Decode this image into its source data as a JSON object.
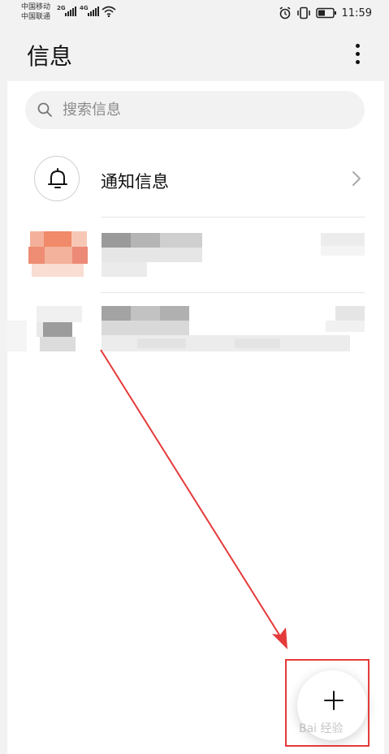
{
  "status_bar": {
    "carrier_1": "中国移动",
    "carrier_2": "中国联通",
    "net_1": "2G",
    "net_2": "4G",
    "time": "11:59",
    "icons": [
      "signal-icon",
      "wifi-icon",
      "alarm-icon",
      "vibrate-icon",
      "battery-icon"
    ]
  },
  "header": {
    "title": "信息",
    "menu_icon": "more-vertical-icon"
  },
  "search": {
    "placeholder": "搜索信息",
    "icon": "search-icon"
  },
  "notification_row": {
    "label": "通知信息",
    "icon": "bell-icon",
    "chevron": "chevron-right-icon"
  },
  "conversations": [
    {
      "redacted": true
    },
    {
      "redacted": true
    }
  ],
  "fab": {
    "icon": "plus-icon"
  },
  "annotation": {
    "arrow_color": "#e53a3a",
    "box_color": "#e53a3a"
  },
  "watermark": "Bai 经验"
}
